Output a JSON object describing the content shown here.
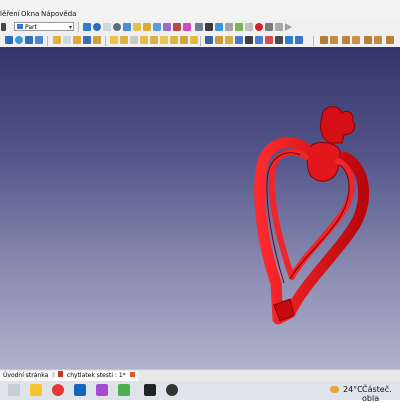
{
  "menu": {
    "items": [
      "lěření",
      "Okna",
      "Nápověda"
    ]
  },
  "toolbar": {
    "workbench_label": "Part"
  },
  "viewport": {
    "model_color": "#e8161c",
    "bg_top": "#32346b",
    "bg_bottom": "#b0b2cc"
  },
  "statusbar": {
    "tabs": [
      "Úvodní stránka",
      "chytlatek stesti : 1*"
    ]
  },
  "taskbar": {
    "temperature": "24°C",
    "weather": "Částeč. obla"
  }
}
